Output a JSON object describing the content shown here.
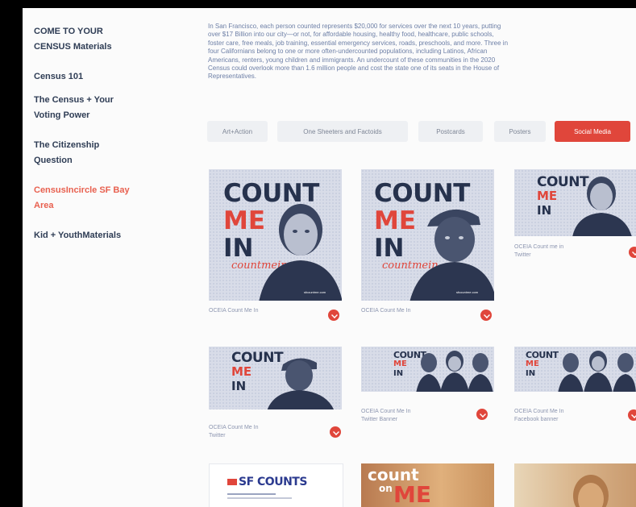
{
  "sidebar": {
    "items": [
      {
        "label": "COME TO YOUR CENSUS Materials",
        "line1": "COME TO YOUR",
        "line2": "CENSUS Materials"
      },
      {
        "label": "Census 101"
      },
      {
        "label": "The Census + Your Voting Power",
        "line1": "The Census + Your",
        "line2": "Voting Power"
      },
      {
        "label": "The Citizenship Question",
        "line1": "The Citizenship",
        "line2": "Question"
      },
      {
        "label": "CensusIncircle SF Bay Area",
        "line1": "CensusIncircle SF Bay",
        "line2": "Area"
      },
      {
        "label": "Kid + YouthMaterials"
      }
    ]
  },
  "intro": {
    "lines": [
      "In San Francisco, each person counted represents $20,000 for services over the next 10 years, putting",
      "over $17 Billion into our city—or not, for affordable housing, healthy food, healthcare, public schools,",
      "foster care, free meals, job training, essential emergency services, roads, preschools, and more. Three in",
      "four Californians belong to one or more often-undercounted populations, including Latinos, African",
      "Americans, renters, young children and immigrants. An undercount of these communities in the 2020",
      "Census could overlook more than 1.6 million people and cost the state one of its seats in the House of",
      "Representatives."
    ]
  },
  "tabs": [
    {
      "label": "Art+Action"
    },
    {
      "label": "One Sheeters and Factoids"
    },
    {
      "label": "Postcards"
    },
    {
      "label": "Posters"
    },
    {
      "label": "Social Media",
      "active": true
    }
  ],
  "poster_text": {
    "count": "COUNT",
    "me": "ME",
    "in": "IN",
    "script": "countmein",
    "web": "sfcountme.com",
    "sf_counts": "SF COUNTS",
    "count_on": "count",
    "on": "on",
    "me2": "ME"
  },
  "cards": [
    {
      "caption": "OCEIA Count Me In"
    },
    {
      "caption": "OCEIA Count Me In"
    },
    {
      "caption_line1": "OCEIA Count me in",
      "caption_line2": "Twitter"
    },
    {
      "caption_line1": "OCEIA Count Me In",
      "caption_line2": "Twitter"
    },
    {
      "caption_line1": "OCEIA Count Me In",
      "caption_line2": "Twitter Banner"
    },
    {
      "caption_line1": "OCEIA Count Me In",
      "caption_line2": "Facebook banner"
    }
  ],
  "colors": {
    "accent": "#e0463b",
    "navy": "#26324d",
    "sidebar_text": "#2f3d55",
    "sidebar_active": "#e8604f",
    "body_text": "#6d7fa6"
  }
}
